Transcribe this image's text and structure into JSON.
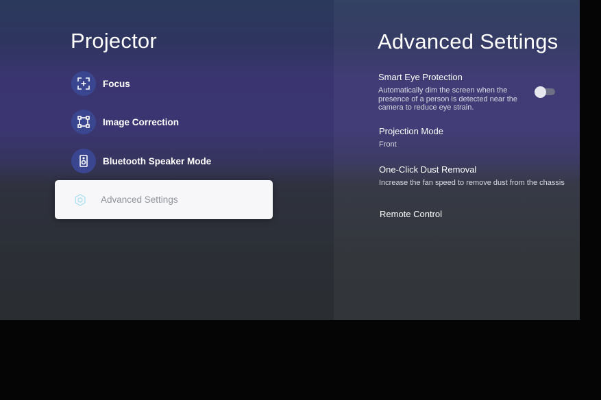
{
  "left_panel": {
    "title": "Projector",
    "items": [
      {
        "label": "Focus",
        "icon": "focus-icon"
      },
      {
        "label": "Image Correction",
        "icon": "image-correction-icon"
      },
      {
        "label": "Bluetooth Speaker Mode",
        "icon": "speaker-icon"
      }
    ],
    "selected_item": {
      "label": "Advanced Settings",
      "icon": "gear-icon"
    }
  },
  "right_panel": {
    "title": "Advanced Settings",
    "settings": [
      {
        "title": "Smart Eye Protection",
        "description_lines": [
          "Automatically dim the screen when the",
          "presence of a person is detected near the",
          "camera to reduce eye strain."
        ],
        "toggle_on": false
      },
      {
        "title": "Projection Mode",
        "value": "Front"
      },
      {
        "title": "One-Click Dust Removal",
        "description": "Increase the fan speed to remove dust from the chassis"
      },
      {
        "title": "Remote Control"
      }
    ]
  },
  "colors": {
    "icon_circle": "#3a4690",
    "selected_bg": "#f7f7f9",
    "selected_text": "#8f939b",
    "selected_icon": "#a6e0ef"
  }
}
